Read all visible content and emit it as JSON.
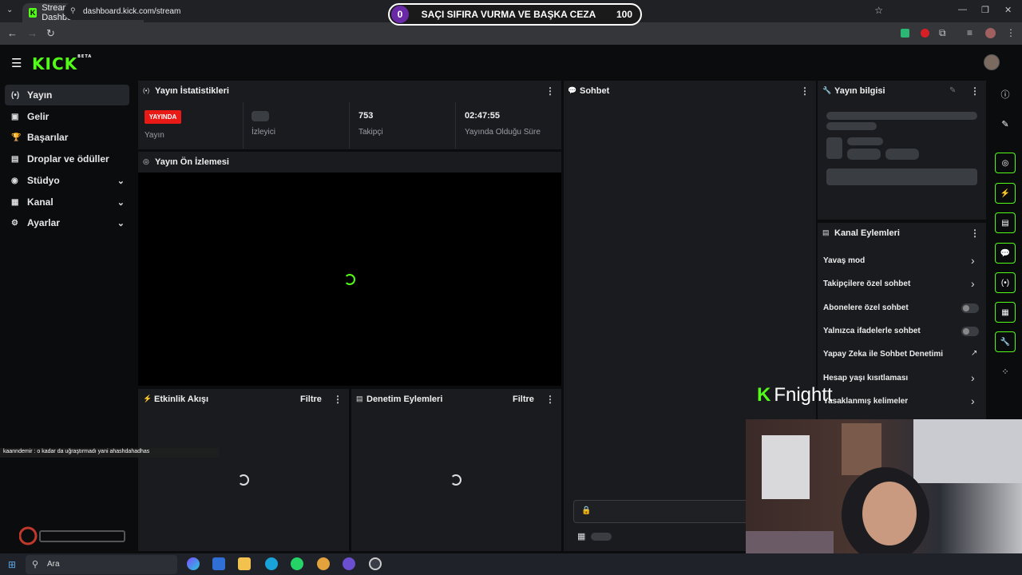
{
  "browser": {
    "tab_title": "Stream - Kick Dashboard",
    "url": "dashboard.kick.com/stream",
    "tab_close": "✕",
    "new_tab": "+"
  },
  "overlay_banner": {
    "left_count": "0",
    "text": "SAÇI SIFIRA VURMA VE BAŞKA CEZA",
    "right_count": "100"
  },
  "logo": {
    "text": "KICK",
    "badge": "BETA"
  },
  "sidebar": {
    "items": [
      {
        "label": "Yayın",
        "icon": "(•)"
      },
      {
        "label": "Gelir",
        "icon": "▣"
      },
      {
        "label": "Başarılar",
        "icon": "🏆"
      },
      {
        "label": "Droplar ve ödüller",
        "icon": "▤"
      },
      {
        "label": "Stüdyo",
        "icon": "◉"
      },
      {
        "label": "Kanal",
        "icon": "▦"
      },
      {
        "label": "Ayarlar",
        "icon": "⚙"
      }
    ]
  },
  "stats_panel": {
    "title": "Yayın İstatistikleri",
    "live_badge": "YAYINDA",
    "live_label": "Yayın",
    "viewers_label": "İzleyici",
    "followers_value": "753",
    "followers_label": "Takipçi",
    "uptime_value": "02:47:55",
    "uptime_label": "Yayında Olduğu Süre"
  },
  "preview_panel": {
    "title": "Yayın Ön İzlemesi"
  },
  "activity_panel": {
    "title": "Etkinlik Akışı",
    "filter": "Filtre"
  },
  "moderation_panel": {
    "title": "Denetim Eylemleri",
    "filter": "Filtre"
  },
  "chat_panel": {
    "title": "Sohbet"
  },
  "stream_info_panel": {
    "title": "Yayın bilgisi"
  },
  "channel_actions": {
    "title": "Kanal Eylemleri",
    "items": [
      {
        "label": "Yavaş mod"
      },
      {
        "label": "Takipçilere özel sohbet"
      },
      {
        "label": "Abonelere özel sohbet"
      },
      {
        "label": "Yalnızca ifadelerle sohbet"
      },
      {
        "label": "Yapay Zeka ile Sohbet Denetimi"
      },
      {
        "label": "Hesap yaşı kısıtlaması"
      },
      {
        "label": "Yasaklanmış kelimeler"
      }
    ]
  },
  "stream_overlay": {
    "chat_message": "kaanndemir : o kadar da uğraştırmadı yani ahashdahadhas",
    "streamer_name": "Fnightt"
  },
  "taskbar": {
    "search_placeholder": "Ara"
  },
  "colors": {
    "accent": "#53fc18",
    "live": "#e91916"
  }
}
